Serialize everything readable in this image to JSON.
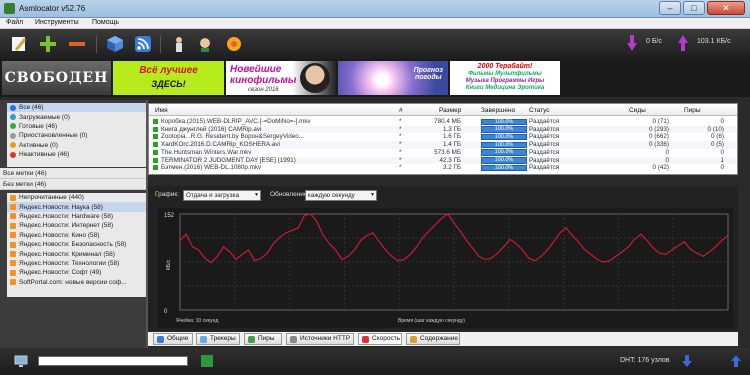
{
  "window": {
    "title": "Asmlocator v52.76",
    "min": "–",
    "max": "□",
    "close": "✕"
  },
  "menu": [
    "Файл",
    "Инструменты",
    "Помощь"
  ],
  "speed": {
    "down": "0 Б/с",
    "up": "103.1 КБ/с"
  },
  "banners": {
    "b1": "СВОБОДЕН",
    "b2": {
      "l1": "Всё лучшее",
      "l2": "ЗДЕСЬ!"
    },
    "b3": {
      "l1": "Новейшие",
      "l2": "кинофильмы",
      "l3": "сезон 2016"
    },
    "b4": {
      "l1": "Прогноз",
      "l2": "погоды"
    },
    "b5": {
      "l1": "2000 Терабайт!",
      "l2": "Фильмы  Мультфильмы",
      "l3": "Музыка  Программы  Игры",
      "l4": "Книги  Медицина  Эротика"
    }
  },
  "sidebar": {
    "status": [
      {
        "label": "Все (46)",
        "color": "#1a73e8"
      },
      {
        "label": "Загружаемые (0)",
        "color": "#2a9ad8"
      },
      {
        "label": "Готовые (46)",
        "color": "#3aa845"
      },
      {
        "label": "Приостановленные (0)",
        "color": "#9a9a9a"
      },
      {
        "label": "Активные (0)",
        "color": "#e2a21a"
      },
      {
        "label": "Неактивные (46)",
        "color": "#d33"
      }
    ],
    "labels": [
      "Все метки (46)",
      "Без метки (46)"
    ],
    "feeds": [
      "Непрочитанные (440)",
      "Яндекс.Новости: Наука (58)",
      "Яндекс.Новости: Hardware (58)",
      "Яндекс.Новости: Интернет (58)",
      "Яндекс.Новости: Кино (58)",
      "Яндекс.Новости: Безопасность (58)",
      "Яндекс.Новости: Криминал (58)",
      "Яндекс.Новости: Технологии (58)",
      "Яндекс.Новости: Софт (49)",
      "SoftPortal.com: новые версии соф..."
    ]
  },
  "table": {
    "headers": {
      "name": "Имя",
      "num": "#",
      "size": "Размер",
      "done": "Завершено",
      "status": "Статус",
      "seeds": "Сиды",
      "peers": "Пиры"
    },
    "rows": [
      {
        "name": "Коробка.(2015).WEB-DLRIP_AVC.[-=DoMiNo=-].mkv",
        "num": "*",
        "size": "780.4 МБ",
        "done": "100.0%",
        "status": "Раздаётся",
        "seeds": "0 (71)",
        "peers": "0"
      },
      {
        "name": "Книга джунглей (2016) CAMRip.avi",
        "num": "*",
        "size": "1.3 ГБ",
        "done": "100.0%",
        "status": "Раздаётся",
        "seeds": "0 (293)",
        "peers": "0 (10)"
      },
      {
        "name": "Zootopia. .R.G. Resident.by Bopoн&SergeyVideo...",
        "num": "*",
        "size": "1.6 ГБ",
        "done": "100.0%",
        "status": "Раздаётся",
        "seeds": "0 (662)",
        "peers": "0 (6)"
      },
      {
        "name": "XardKOrc.2016.D.CAMRip_KOSHERA.avi",
        "num": "*",
        "size": "1.4 ГБ",
        "done": "100.0%",
        "status": "Раздаётся",
        "seeds": "0 (336)",
        "peers": "0 (5)"
      },
      {
        "name": "The.Huntsman.Winters.War.mkv",
        "num": "*",
        "size": "573.6 МБ",
        "done": "100.0%",
        "status": "Раздаётся",
        "seeds": "0",
        "peers": "0"
      },
      {
        "name": "TERMINATOR 2 JUDGMENT DAY [ESE] (1991)",
        "num": "*",
        "size": "42.3 ГБ",
        "done": "100.0%",
        "status": "Раздаётся",
        "seeds": "0",
        "peers": "1"
      },
      {
        "name": "Бэтмен.(2016) WEB-DL.1080p.mkv",
        "num": "*",
        "size": "3.2 ГБ",
        "done": "100.0%",
        "status": "Раздаётся",
        "seeds": "0 (42)",
        "peers": "0"
      }
    ]
  },
  "chart_controls": {
    "graph_label": "График:",
    "graph_value": "Отдача и загрузка",
    "update_label": "Обновление:",
    "update_value": "каждую секунду"
  },
  "chart_data": {
    "type": "line",
    "ylabel": "КБ/с",
    "xlabel": "Время (шаг каждую секунду)",
    "left_note": "Ячейка: 10 секунд",
    "y_top_label": "152",
    "y_bottom_label": "0",
    "ylim": [
      0,
      152
    ],
    "series": [
      {
        "color": "#cc1a33",
        "values": [
          110,
          120,
          100,
          95,
          82,
          75,
          85,
          100,
          92,
          80,
          88,
          95,
          78,
          82,
          90,
          105,
          115,
          122,
          126,
          130,
          150,
          158,
          140,
          118,
          105,
          95,
          80,
          85,
          95,
          110,
          118,
          122,
          108,
          95,
          85,
          78,
          80,
          88,
          100,
          115,
          125,
          135,
          145,
          152,
          138,
          125,
          110,
          98,
          85,
          80,
          82,
          90,
          100,
          112,
          105,
          95,
          82,
          78,
          85,
          95,
          108,
          122,
          130,
          118,
          108,
          95,
          88,
          80,
          76,
          78,
          85,
          92,
          100,
          112,
          120,
          110,
          98,
          90,
          88,
          95,
          102,
          108,
          96,
          90,
          85,
          92,
          100,
          110,
          118
        ]
      }
    ]
  },
  "tabs": [
    "Общие",
    "Трекеры",
    "Пиры",
    "Источники HTTP",
    "Скорость",
    "Содержание"
  ],
  "status": {
    "dht": "DHT: 176 узлов"
  }
}
